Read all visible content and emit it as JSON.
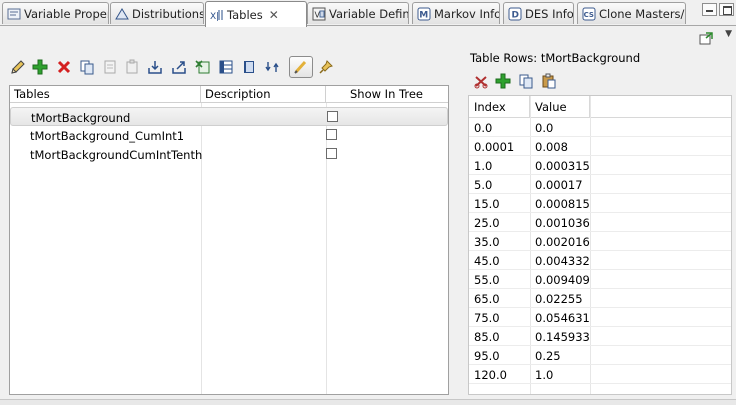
{
  "tabs": [
    {
      "label": "Variable Proper",
      "icon": "properties-icon",
      "active": false
    },
    {
      "label": "Distributions",
      "icon": "distributions-icon",
      "active": false
    },
    {
      "label": "Tables",
      "icon": "table-icon",
      "active": true
    },
    {
      "label": "Variable Definit",
      "icon": "variable-definition-icon",
      "active": false
    },
    {
      "label": "Markov Info",
      "icon": "markov-icon",
      "active": false
    },
    {
      "label": "DES Info",
      "icon": "des-icon",
      "active": false
    },
    {
      "label": "Clone Masters/",
      "icon": "clone-icon",
      "active": false
    }
  ],
  "toolbar_icons": [
    "edit-icon",
    "add-icon",
    "delete-icon",
    "copy-icon",
    "paste-icon",
    "clipboard-icon",
    "import-icon",
    "export-icon",
    "excel-icon",
    "table-view-icon",
    "book-icon",
    "refresh-icon",
    "highlight-icon",
    "pin-icon"
  ],
  "tables_panel": {
    "columns": [
      "Tables",
      "Description",
      "Show In Tree"
    ],
    "rows": [
      {
        "name": "tMortBackground",
        "description": "",
        "show_in_tree": false
      },
      {
        "name": "tMortBackground_CumInt1",
        "description": "",
        "show_in_tree": false
      },
      {
        "name": "tMortBackgroundCumIntTenth",
        "description": "",
        "show_in_tree": false
      }
    ],
    "selected_index": 0
  },
  "rows_panel": {
    "title": "Table Rows: tMortBackground",
    "toolbar_icons": [
      "delete-icon",
      "add-icon",
      "copy-icon",
      "paste-icon"
    ],
    "columns": [
      "Index",
      "Value"
    ],
    "rows": [
      {
        "index": "0.0",
        "value": "0.0"
      },
      {
        "index": "0.0001",
        "value": "0.008"
      },
      {
        "index": "1.0",
        "value": "0.000315"
      },
      {
        "index": "5.0",
        "value": "0.00017"
      },
      {
        "index": "15.0",
        "value": "0.000815"
      },
      {
        "index": "25.0",
        "value": "0.001036"
      },
      {
        "index": "35.0",
        "value": "0.002016"
      },
      {
        "index": "45.0",
        "value": "0.004332"
      },
      {
        "index": "55.0",
        "value": "0.009409"
      },
      {
        "index": "65.0",
        "value": "0.02255"
      },
      {
        "index": "75.0",
        "value": "0.054631"
      },
      {
        "index": "85.0",
        "value": "0.145933"
      },
      {
        "index": "95.0",
        "value": "0.25"
      },
      {
        "index": "120.0",
        "value": "1.0"
      }
    ]
  }
}
